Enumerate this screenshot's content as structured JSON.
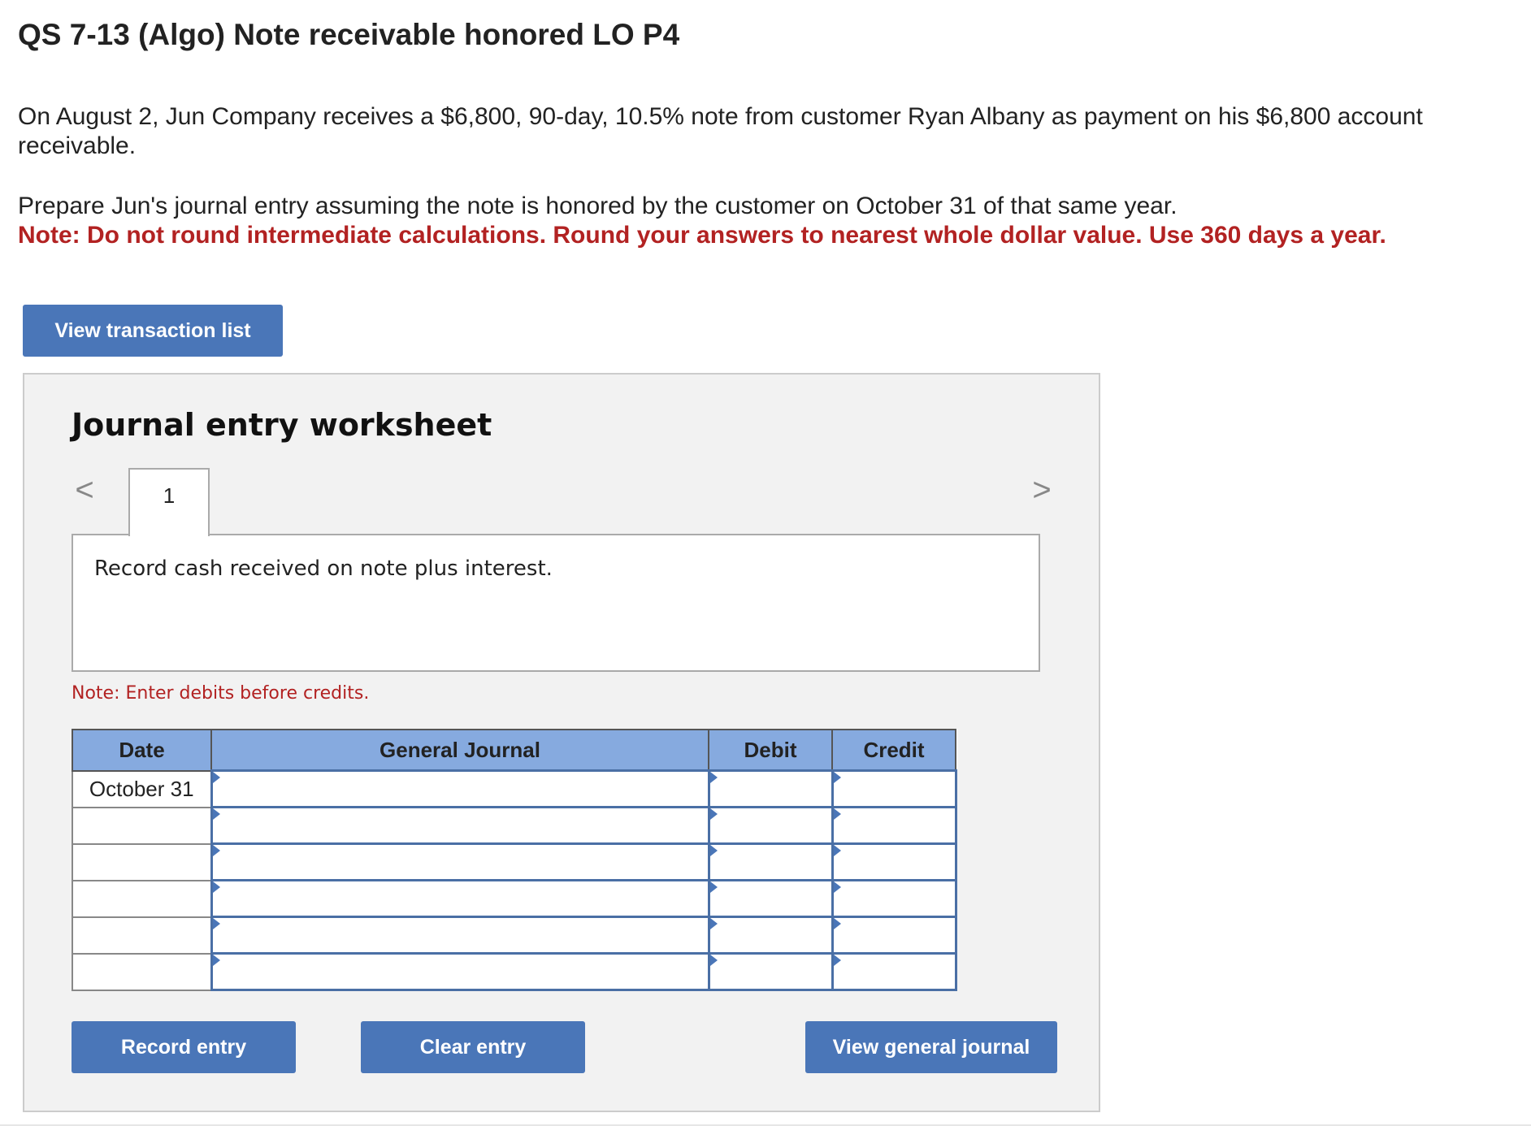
{
  "question": {
    "title": "QS 7-13 (Algo) Note receivable honored LO P4",
    "intro": "On August 2, Jun Company receives a $6,800, 90-day, 10.5% note from customer Ryan Albany as payment on his $6,800 account receivable.",
    "instruction": "Prepare Jun's journal entry assuming the note is honored by the customer on October 31 of that same year.",
    "note": "Note: Do not round intermediate calculations. Round your answers to nearest whole dollar value. Use 360 days a year."
  },
  "buttons": {
    "view_transaction_list": "View transaction list",
    "record_entry": "Record entry",
    "clear_entry": "Clear entry",
    "view_general_journal": "View general journal"
  },
  "worksheet": {
    "title": "Journal entry worksheet",
    "prev_arrow": "<",
    "next_arrow": ">",
    "tab_label": "1",
    "description": "Record cash received on note plus interest.",
    "note": "Note: Enter debits before credits.",
    "table": {
      "headers": {
        "date": "Date",
        "general_journal": "General Journal",
        "debit": "Debit",
        "credit": "Credit"
      },
      "rows": [
        {
          "date": "October 31",
          "account": "",
          "debit": "",
          "credit": ""
        },
        {
          "date": "",
          "account": "",
          "debit": "",
          "credit": ""
        },
        {
          "date": "",
          "account": "",
          "debit": "",
          "credit": ""
        },
        {
          "date": "",
          "account": "",
          "debit": "",
          "credit": ""
        },
        {
          "date": "",
          "account": "",
          "debit": "",
          "credit": ""
        },
        {
          "date": "",
          "account": "",
          "debit": "",
          "credit": ""
        }
      ]
    }
  },
  "colors": {
    "button_blue": "#4a76b8",
    "header_blue": "#86aadf",
    "note_red": "#b22222",
    "panel_gray": "#f2f2f2"
  },
  "icons": {
    "prev": "chevron-left-icon",
    "next": "chevron-right-icon",
    "input_marker": "triangle-marker-icon"
  }
}
